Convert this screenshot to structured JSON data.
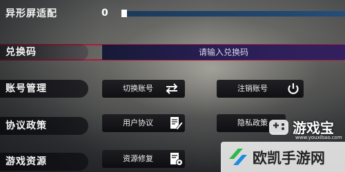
{
  "settings": {
    "screen_adapt": {
      "label": "异形屏适配",
      "value": "0",
      "level": 0.0
    },
    "redeem": {
      "label": "兑换码",
      "placeholder": "请输入兑换码"
    },
    "account": {
      "label": "账号管理",
      "switch_label": "切换账号",
      "logout_label": "注销账号"
    },
    "policy": {
      "label": "协议政策",
      "user_agreement_label": "用户协议",
      "privacy_label": "隐私政策"
    },
    "resources": {
      "label": "游戏资源",
      "repair_label": "资源修复"
    }
  },
  "watermarks": {
    "top_text": "游戏宝",
    "top_url": "www.youxibao.com",
    "bottom_text": "欧凯手游网"
  },
  "colors": {
    "highlight_border": "#b01a3a",
    "slider_track": "#244d78",
    "redeem_field": "#2a1f56",
    "logo_green": "#2db84a",
    "logo_blue": "#1a8de0"
  },
  "icons": [
    "switch-arrows-icon",
    "power-icon",
    "document-edit-icon",
    "document-gear-icon",
    "gamepad-logo-icon",
    "okai-logo-icon"
  ]
}
